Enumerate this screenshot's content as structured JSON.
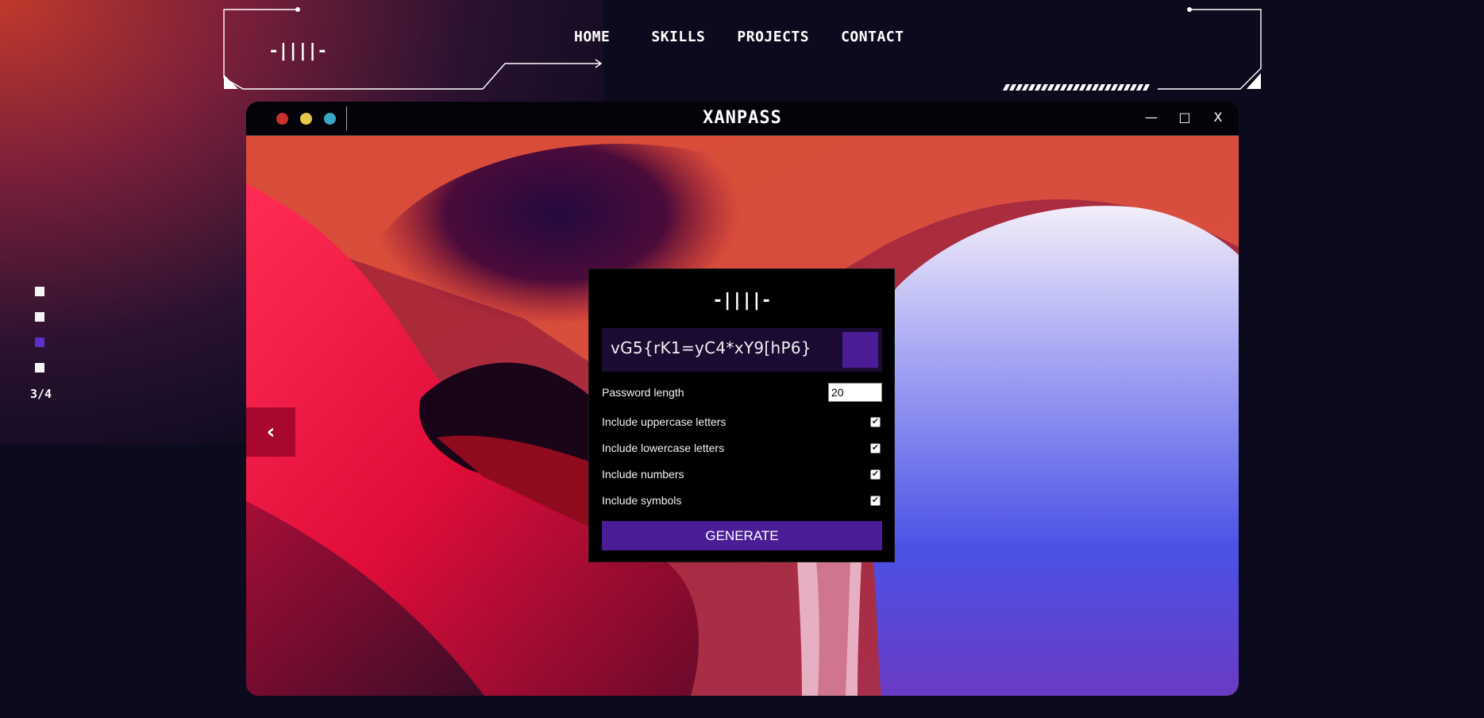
{
  "header": {
    "logo": "-||||-",
    "nav": [
      {
        "label": "HOME"
      },
      {
        "label": "SKILLS"
      },
      {
        "label": "PROJECTS"
      },
      {
        "label": "CONTACT"
      }
    ]
  },
  "pager": {
    "dots": 4,
    "active_index": 3,
    "counter": "3/4"
  },
  "window": {
    "title": "XANPASS",
    "controls": {
      "minimize": "—",
      "maximize": "□",
      "close": "X"
    },
    "prev_button": "‹"
  },
  "generator": {
    "logo": "-||||-",
    "password": "vG5{rK1=yC4*xY9[hP6}",
    "length_label": "Password length",
    "length_value": "20",
    "options": [
      {
        "label": "Include uppercase letters",
        "checked": true
      },
      {
        "label": "Include lowercase letters",
        "checked": true
      },
      {
        "label": "Include numbers",
        "checked": true
      },
      {
        "label": "Include symbols",
        "checked": true
      }
    ],
    "generate_label": "GENERATE"
  },
  "colors": {
    "background": "#0c0a1d",
    "accent": "#4a1d96",
    "active_dot": "#5b2fc9",
    "prev_button": "#a8082e"
  }
}
